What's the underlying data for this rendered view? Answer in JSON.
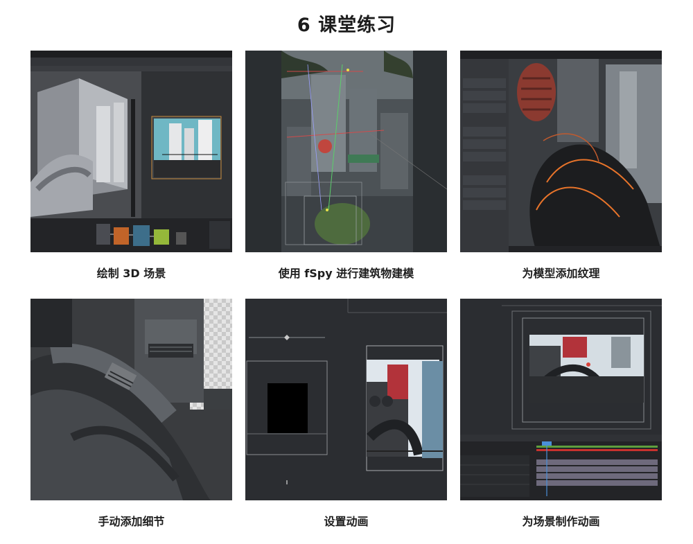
{
  "page": {
    "title": "6 课堂练习"
  },
  "cards": [
    {
      "caption": "绘制 3D 场景",
      "thumbnail_icon": "blender-3d-scene-image"
    },
    {
      "caption": "使用 fSpy 进行建筑物建模",
      "thumbnail_icon": "fspy-building-image"
    },
    {
      "caption": "为模型添加纹理",
      "thumbnail_icon": "texture-model-image"
    },
    {
      "caption": "手动添加细节",
      "thumbnail_icon": "detail-pipes-image"
    },
    {
      "caption": "设置动画",
      "thumbnail_icon": "animation-camera-image"
    },
    {
      "caption": "为场景制作动画",
      "thumbnail_icon": "scene-animation-timeline-image"
    }
  ],
  "colors": {
    "background": "#ffffff",
    "title": "#1c1c1c",
    "caption": "#1e1e1e",
    "ui_dark": "#2a2c2f",
    "accent_orange": "#e8742a",
    "accent_red": "#c8322e"
  }
}
